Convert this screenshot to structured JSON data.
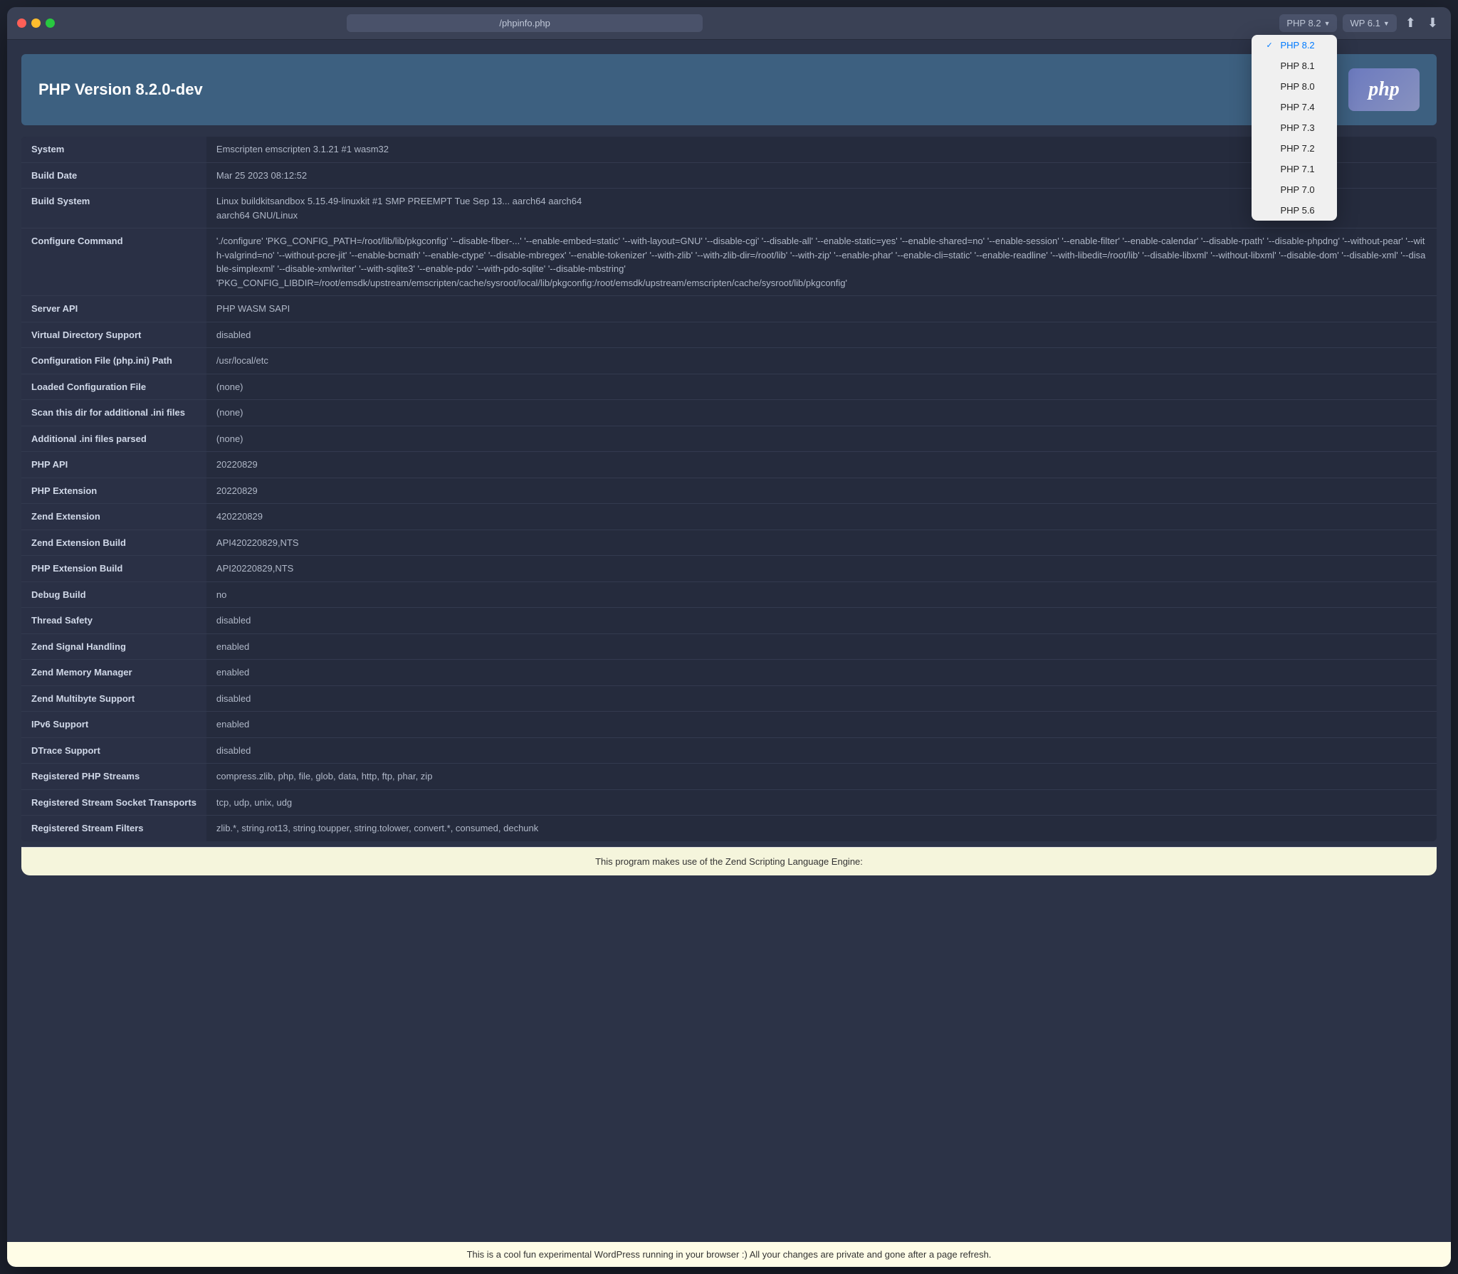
{
  "titlebar": {
    "url": "/phpinfo.php",
    "php_version_current": "PHP 8.2",
    "wp_version_current": "WP 6.1",
    "upload_icon": "↑",
    "download_icon": "↓"
  },
  "php_versions": [
    {
      "label": "PHP 8.2",
      "selected": true
    },
    {
      "label": "PHP 8.1",
      "selected": false
    },
    {
      "label": "PHP 8.0",
      "selected": false
    },
    {
      "label": "PHP 7.4",
      "selected": false
    },
    {
      "label": "PHP 7.3",
      "selected": false
    },
    {
      "label": "PHP 7.2",
      "selected": false
    },
    {
      "label": "PHP 7.1",
      "selected": false
    },
    {
      "label": "PHP 7.0",
      "selected": false
    },
    {
      "label": "PHP 5.6",
      "selected": false
    }
  ],
  "header": {
    "title": "PHP Version 8.2.0-dev",
    "logo": "php"
  },
  "table_rows": [
    {
      "label": "System",
      "value": "Emscripten emscripten 3.1.21 #1 wasm32"
    },
    {
      "label": "Build Date",
      "value": "Mar 25 2023 08:12:52"
    },
    {
      "label": "Build System",
      "value": "Linux buildkitsandbox 5.15.49-linuxkit #1 SMP PREEMPT Tue Sep 13... aarch64 aarch64\naarch64 GNU/Linux"
    },
    {
      "label": "Configure Command",
      "value": "'./configure' 'PKG_CONFIG_PATH=/root/lib/lib/pkgconfig' '--disable-fiber-...' '--enable-embed=static' '--with-layout=GNU' '--disable-cgi' '--disable-all' '--enable-static=yes' '--enable-shared=no' '--enable-session' '--enable-filter' '--enable-calendar' '--disable-rpath' '--disable-phpdng' '--without-pear' '--with-valgrind=no' '--without-pcre-jit' '--enable-bcmath' '--enable-ctype' '--disable-mbregex' '--enable-tokenizer' '--with-zlib' '--with-zlib-dir=/root/lib' '--with-zip' '--enable-phar' '--enable-cli=static' '--enable-readline' '--with-libedit=/root/lib' '--disable-libxml' '--without-libxml' '--disable-dom' '--disable-xml' '--disable-simplexml' '--disable-xmlwriter' '--with-sqlite3' '--enable-pdo' '--with-pdo-sqlite' '--disable-mbstring'\n'PKG_CONFIG_LIBDIR=/root/emsdk/upstream/emscripten/cache/sysroot/local/lib/pkgconfig:/root/emsdk/upstream/emscripten/cache/sysroot/lib/pkgconfig'"
    },
    {
      "label": "Server API",
      "value": "PHP WASM SAPI"
    },
    {
      "label": "Virtual Directory Support",
      "value": "disabled"
    },
    {
      "label": "Configuration File (php.ini) Path",
      "value": "/usr/local/etc"
    },
    {
      "label": "Loaded Configuration File",
      "value": "(none)"
    },
    {
      "label": "Scan this dir for additional .ini files",
      "value": "(none)"
    },
    {
      "label": "Additional .ini files parsed",
      "value": "(none)"
    },
    {
      "label": "PHP API",
      "value": "20220829"
    },
    {
      "label": "PHP Extension",
      "value": "20220829"
    },
    {
      "label": "Zend Extension",
      "value": "420220829"
    },
    {
      "label": "Zend Extension Build",
      "value": "API420220829,NTS"
    },
    {
      "label": "PHP Extension Build",
      "value": "API20220829,NTS"
    },
    {
      "label": "Debug Build",
      "value": "no"
    },
    {
      "label": "Thread Safety",
      "value": "disabled"
    },
    {
      "label": "Zend Signal Handling",
      "value": "enabled"
    },
    {
      "label": "Zend Memory Manager",
      "value": "enabled"
    },
    {
      "label": "Zend Multibyte Support",
      "value": "disabled"
    },
    {
      "label": "IPv6 Support",
      "value": "enabled"
    },
    {
      "label": "DTrace Support",
      "value": "disabled"
    },
    {
      "label": "Registered PHP Streams",
      "value": "compress.zlib, php, file, glob, data, http, ftp, phar, zip"
    },
    {
      "label": "Registered Stream Socket Transports",
      "value": "tcp, udp, unix, udg"
    },
    {
      "label": "Registered Stream Filters",
      "value": "zlib.*, string.rot13, string.toupper, string.tolower, convert.*, consumed, dechunk"
    }
  ],
  "footer": {
    "note": "This program makes use of the Zend Scripting Language Engine:"
  },
  "status_bar": {
    "message": "This is a cool fun experimental WordPress running in your browser :) All your changes are private and gone after a page refresh."
  }
}
